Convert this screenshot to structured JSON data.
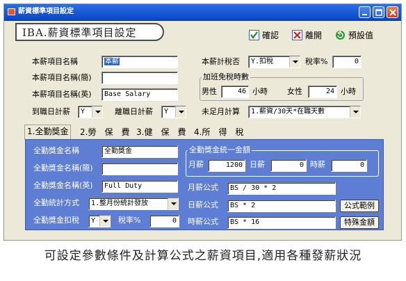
{
  "window": {
    "title": "薪資標準項目設定"
  },
  "header": {
    "title": "IBA.薪資標準項目設定"
  },
  "toolbar": {
    "confirm_label": "確認",
    "leave_label": "離開",
    "default_label": "預設值"
  },
  "form": {
    "item_name_label": "本薪項目名稱",
    "item_name_value": "本薪",
    "item_short_label": "本薪項目名稱(簡)",
    "item_short_value": "",
    "item_en_label": "本薪項目名稱(英)",
    "item_en_value": "Base Salary",
    "onboard_label": "到職日計薪",
    "onboard_value": "Y",
    "leave_label": "離職日計薪",
    "leave_value": "Y",
    "tax_label": "本薪計稅否",
    "tax_value": "Y.扣稅",
    "tax_rate_label": "稅率%",
    "tax_rate_value": "0",
    "overtime_group_label": "加班免稅時數",
    "male_label": "男性",
    "male_value": "46",
    "female_label": "女性",
    "female_value": "24",
    "hours_unit": "小時",
    "partial_month_label": "未足月計算",
    "partial_month_value": "1.薪資/30天*在職天數"
  },
  "tabs": [
    "1.全勤獎金",
    "2.勞　保　費",
    "3.健　保　費",
    "4.所　得　稅"
  ],
  "panel": {
    "bonus_name_label": "全勤獎金名稱",
    "bonus_name_value": "全勤獎金",
    "bonus_short_label": "全勤獎金名稱(簡)",
    "bonus_short_value": "",
    "bonus_en_label": "全勤獎金名稱(英)",
    "bonus_en_value": "Full Duty",
    "method_label": "全勤統計方式",
    "method_value": "1.整月份統計發放",
    "bonus_tax_label": "全勤獎金扣稅",
    "bonus_tax_value": "Y",
    "bonus_tax_rate_label": "稅率%",
    "bonus_tax_rate_value": "0",
    "uniform_group_label": "全勤獎金統一金額",
    "monthly_label": "月薪",
    "monthly_value": "1200",
    "daily_label": "日薪",
    "daily_value": "0",
    "hourly_label": "時薪",
    "hourly_value": "0",
    "monthly_formula_label": "月薪公式",
    "monthly_formula_value": "BS / 30 * 2",
    "daily_formula_label": "日薪公式",
    "daily_formula_value": "BS * 2",
    "hourly_formula_label": "時薪公式",
    "hourly_formula_value": "BS * 16",
    "formula_example_button": "公式範例",
    "special_amount_button": "特殊金額"
  },
  "caption": "可設定參數條件及計算公式之薪資項目,適用各種發薪狀況"
}
